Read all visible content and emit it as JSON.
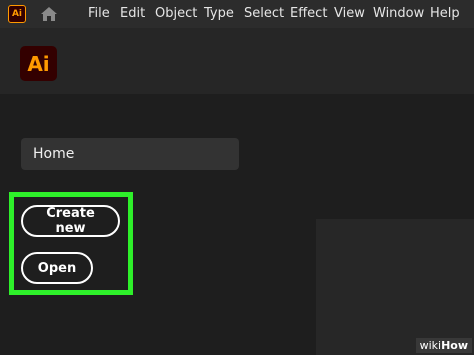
{
  "app": {
    "badge_text": "Ai",
    "logo_text": "Ai",
    "brand_color": "#ff9a00",
    "brand_bg": "#330000"
  },
  "menu": {
    "items": [
      "File",
      "Edit",
      "Object",
      "Type",
      "Select",
      "Effect",
      "View",
      "Window",
      "Help"
    ]
  },
  "nav": {
    "home_label": "Home"
  },
  "actions": {
    "create_new_label": "Create new",
    "open_label": "Open"
  },
  "highlight": {
    "color": "#2ef02a"
  },
  "watermark": {
    "prefix": "wiki",
    "suffix": "How"
  }
}
